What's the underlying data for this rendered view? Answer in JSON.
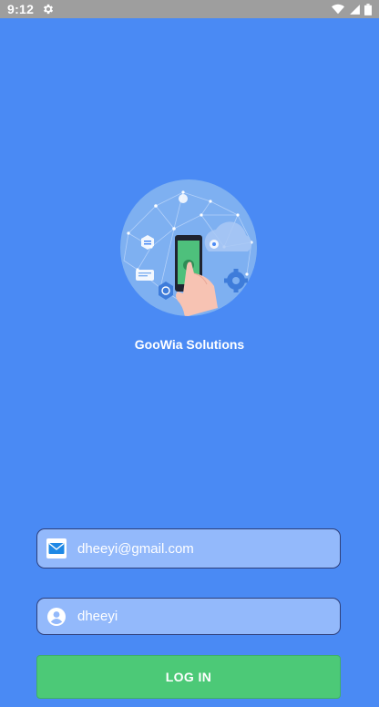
{
  "status_bar": {
    "time": "9:12"
  },
  "hero": {
    "app_name": "GooWia Solutions"
  },
  "form": {
    "email_value": "dheeyi@gmail.com",
    "username_value": "dheeyi",
    "login_label": "LOG IN"
  },
  "colors": {
    "background": "#4A8AF4",
    "status_bar": "#9E9E9E",
    "field_fill": "#93B9FB",
    "field_border": "#2E3F7A",
    "login_button": "#4CC977"
  },
  "icons": {
    "settings": "gear-icon",
    "wifi": "wifi-icon",
    "signal": "signal-icon",
    "battery": "battery-icon",
    "email": "mail-icon",
    "user": "user-icon"
  }
}
